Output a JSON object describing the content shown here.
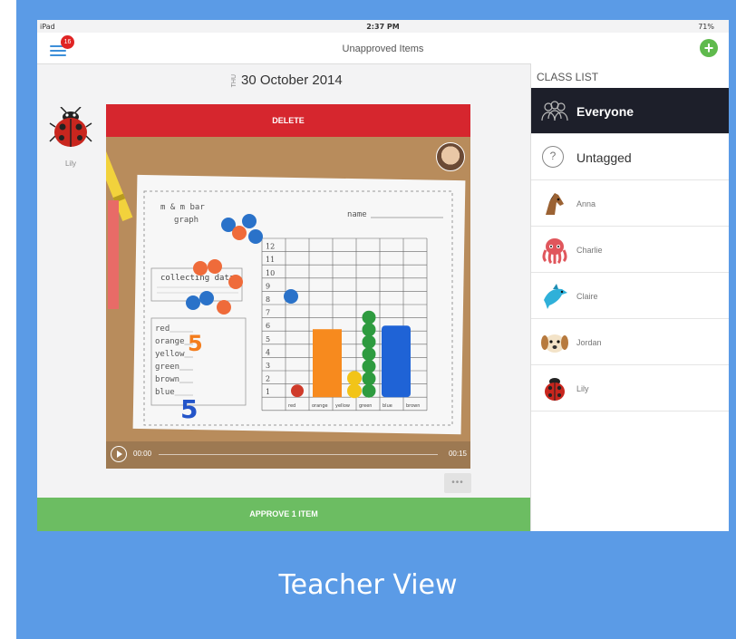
{
  "status": {
    "device": "iPad",
    "time": "2:37 PM",
    "battery": "71%"
  },
  "nav": {
    "title": "Unapproved Items",
    "badge_count": "16"
  },
  "date": {
    "weekday": "THU",
    "text": "30 October 2014"
  },
  "student": {
    "name": "Lily"
  },
  "actions": {
    "delete": "DELETE",
    "approve": "APPROVE 1 ITEM",
    "more": "•••"
  },
  "video": {
    "current_time": "00:00",
    "duration": "00:15"
  },
  "classlist": {
    "heading": "CLASS LIST",
    "items": [
      {
        "label": "Everyone",
        "icon": "group-icon"
      },
      {
        "label": "Untagged",
        "icon": "question-icon"
      },
      {
        "label": "Anna",
        "icon": "horse-icon"
      },
      {
        "label": "Charlie",
        "icon": "octopus-icon"
      },
      {
        "label": "Claire",
        "icon": "dolphin-icon"
      },
      {
        "label": "Jordan",
        "icon": "dog-icon"
      },
      {
        "label": "Lily",
        "icon": "ladybug-icon"
      }
    ]
  },
  "worksheet": {
    "title": "m & m bar graph",
    "name_label": "name",
    "box_heading": "collecting data",
    "colors": [
      "red",
      "orange",
      "yellow",
      "green",
      "brown",
      "blue"
    ],
    "orange_count": "5",
    "blue_count": "5",
    "y_ticks": [
      "12",
      "11",
      "10",
      "9",
      "8",
      "7",
      "6",
      "5",
      "4",
      "3",
      "2",
      "1"
    ],
    "x_labels": [
      "red",
      "orange",
      "yellow",
      "green",
      "blue",
      "brown"
    ]
  },
  "caption": "Teacher View"
}
